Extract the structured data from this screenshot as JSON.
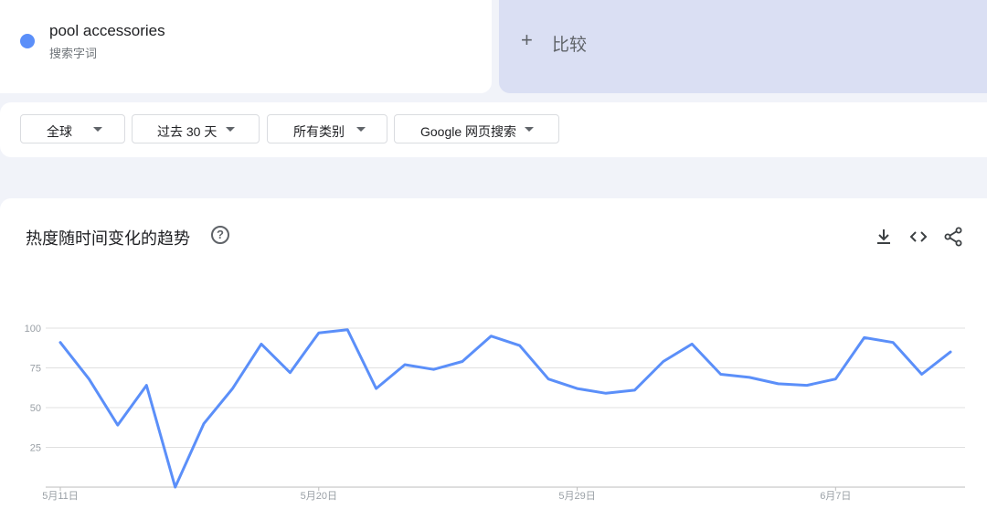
{
  "search_term": {
    "name": "pool accessories",
    "type_label": "搜索字词",
    "color": "#5b8ff9"
  },
  "compare": {
    "plus": "+",
    "label": "比较"
  },
  "filters": {
    "region": "全球",
    "time_range": "过去 30 天",
    "category": "所有类别",
    "search_type": "Google 网页搜索"
  },
  "chart": {
    "title": "热度随时间变化的趋势",
    "help_icon": "question-circle-icon",
    "toolbar_icons": [
      "download-icon",
      "embed-code-icon",
      "share-icon"
    ]
  },
  "chart_data": {
    "type": "line",
    "x": [
      "5月11日",
      "5月12日",
      "5月13日",
      "5月14日",
      "5月15日",
      "5月16日",
      "5月17日",
      "5月18日",
      "5月19日",
      "5月20日",
      "5月21日",
      "5月22日",
      "5月23日",
      "5月24日",
      "5月25日",
      "5月26日",
      "5月27日",
      "5月28日",
      "5月29日",
      "5月30日",
      "5月31日",
      "6月1日",
      "6月2日",
      "6月3日",
      "6月4日",
      "6月5日",
      "6月6日",
      "6月7日",
      "6月8日",
      "6月9日",
      "6月10日",
      "6月11日"
    ],
    "series": [
      {
        "values": [
          91,
          68,
          39,
          64,
          0,
          40,
          62,
          90,
          72,
          97,
          99,
          62,
          77,
          74,
          79,
          95,
          89,
          68,
          62,
          59,
          61,
          79,
          90,
          71,
          69,
          65,
          64,
          68,
          94,
          91,
          71,
          85
        ],
        "color": "#5b8ff9"
      }
    ],
    "x_tick_labels": [
      "5月11日",
      "5月20日",
      "5月29日",
      "6月7日"
    ],
    "x_tick_indices": [
      0,
      9,
      18,
      27
    ],
    "y_ticks": [
      25,
      50,
      75,
      100
    ],
    "ylim": [
      0,
      100
    ],
    "grid": true
  }
}
